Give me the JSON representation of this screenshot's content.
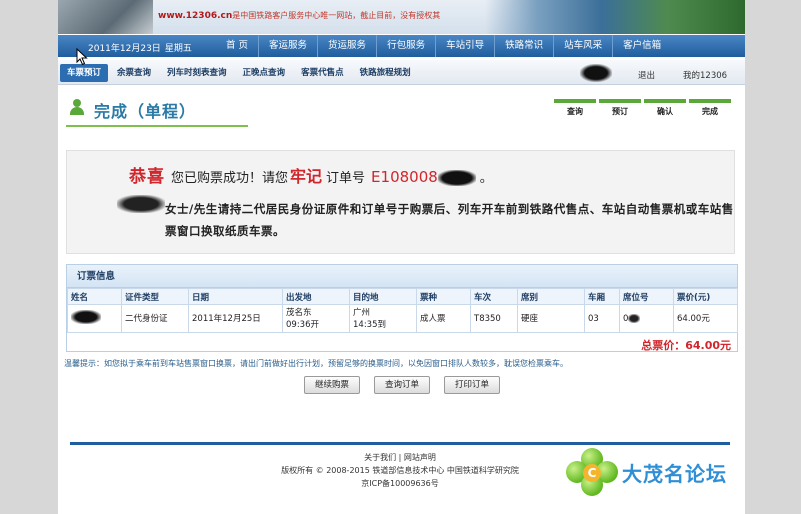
{
  "banner": {
    "site": "www.12306.cn",
    "slogan": "是中国铁路客户服务中心唯一网站，截止目前，没有授权其"
  },
  "navbar": {
    "date": "2011年12月23日",
    "weekday": "星期五",
    "items": [
      "首 页",
      "客运服务",
      "货运服务",
      "行包服务",
      "车站引导",
      "铁路常识",
      "站车风采",
      "客户信箱"
    ]
  },
  "subnav": {
    "items": [
      "车票预订",
      "余票查询",
      "列车时刻表查询",
      "正晚点查询",
      "客票代售点",
      "铁路旅程规划"
    ],
    "logout": "退出",
    "my_account": "我的12306"
  },
  "page": {
    "title": "完成（单程）",
    "steps": [
      "查询",
      "预订",
      "确认",
      "完成"
    ]
  },
  "success": {
    "congrats": "恭喜",
    "message": "您已购票成功！请您",
    "remember": "牢记",
    "order_label": "订单号",
    "order_prefix": "E108008",
    "period": "。",
    "instruction": "女士/先生请持二代居民身份证原件和订单号于购票后、列车开车前到铁路代售点、车站自动售票机或车站售票窗口换取纸质车票。"
  },
  "order": {
    "header": "订票信息",
    "columns": [
      "姓名",
      "证件类型",
      "日期",
      "出发地",
      "目的地",
      "票种",
      "车次",
      "席别",
      "车厢",
      "席位号",
      "票价(元)"
    ],
    "rows": [
      {
        "id_type": "二代身份证",
        "date": "2011年12月25日",
        "from_station": "茂名东",
        "from_time": "09:36开",
        "to_station": "广州",
        "to_time": "14:35到",
        "ticket_type": "成人票",
        "train": "T8350",
        "seat_class": "硬座",
        "carriage": "03",
        "seat_no_prefix": "0",
        "price": "64.00元"
      }
    ],
    "total": "总票价：64.00元"
  },
  "tip": "温馨提示：如您拟于乘车前到车站售票窗口换票，请出门前做好出行计划，预留足够的换票时间，以免因窗口排队人数较多，耽误您检票乘车。",
  "buttons": [
    "继续购票",
    "查询订单",
    "打印订单"
  ],
  "footer": {
    "links": "关于我们 | 网站声明",
    "copyright": "版权所有 © 2008-2015 铁道部信息技术中心 中国铁道科学研究院",
    "icp": "京ICP备10009636号"
  },
  "watermark": {
    "letter": "C",
    "text": "大茂名论坛"
  }
}
